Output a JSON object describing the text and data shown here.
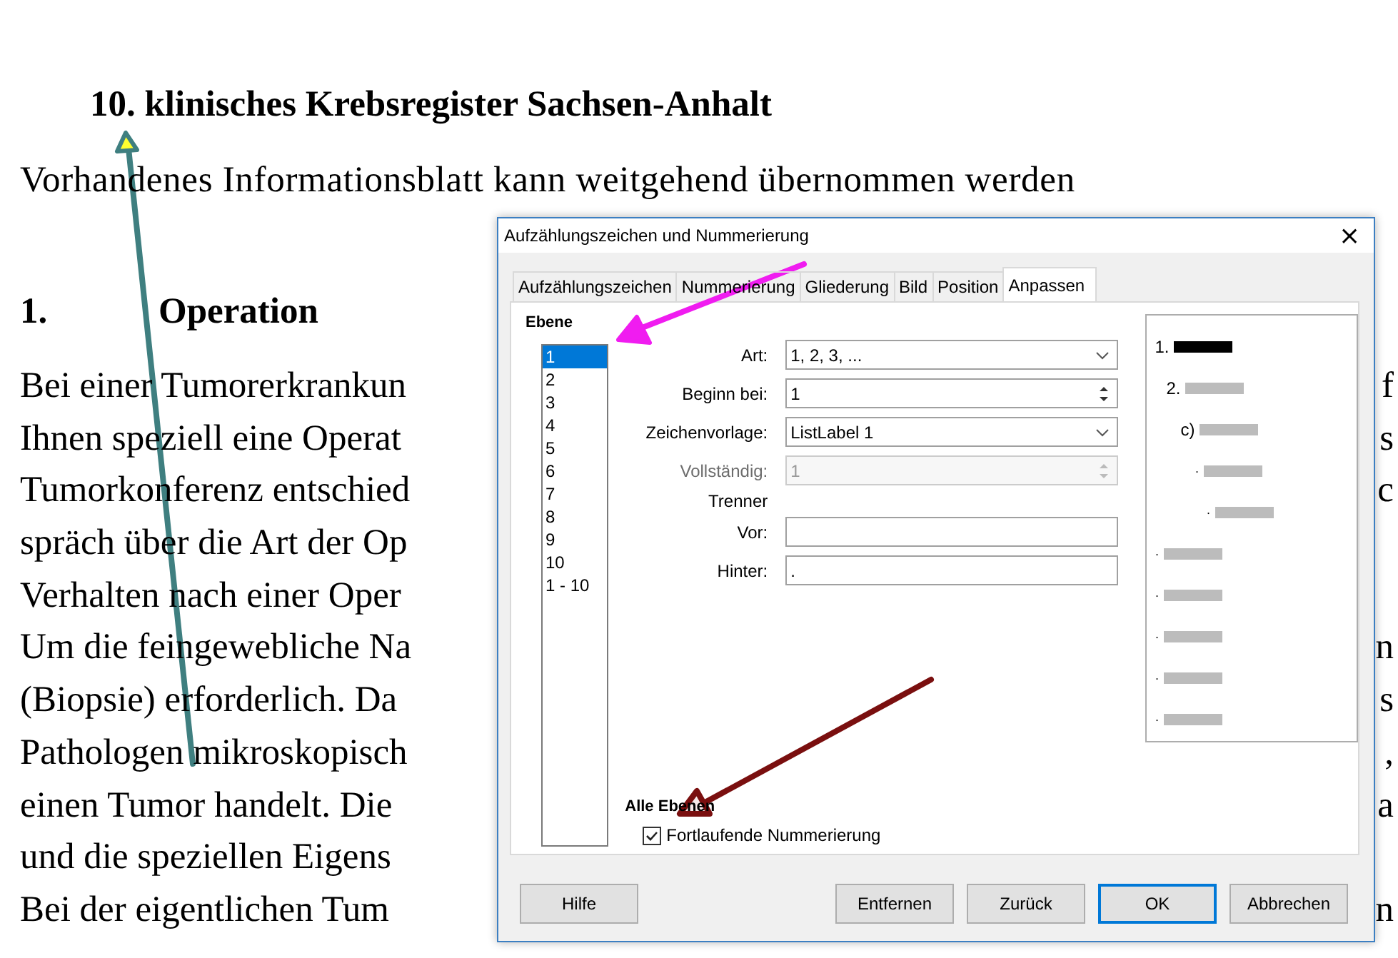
{
  "document": {
    "heading": "10. klinisches Krebsregister Sachsen-Anhalt",
    "intro": "Vorhandenes Informationsblatt kann weitgehend übernommen werden",
    "section": {
      "number": "1.",
      "title": "Operation"
    },
    "lines": [
      {
        "left": "Bei einer Tumorerkrankun",
        "right": "f"
      },
      {
        "left": "Ihnen speziell eine Operat",
        "right": "s"
      },
      {
        "left": "Tumorkonferenz entschied",
        "right": "c"
      },
      {
        "left": "spräch über die Art der Op"
      },
      {
        "left": "Verhalten nach einer Oper"
      },
      {
        "left": "Um die feingewebliche Na",
        "right": "n"
      },
      {
        "left": "(Biopsie) erforderlich. Da",
        "right": "s"
      },
      {
        "left": "Pathologen mikroskopisch",
        "right": ","
      },
      {
        "left": "einen Tumor handelt. Die",
        "right": "a"
      },
      {
        "left": "und die speziellen Eigens"
      },
      {
        "left": "Bei der eigentlichen Tum",
        "right": "n"
      }
    ]
  },
  "dialog": {
    "title": "Aufzählungszeichen und Nummerierung",
    "close": "×",
    "tabs": [
      {
        "label": "Aufzählungszeichen",
        "selected": false
      },
      {
        "label": "Nummerierung",
        "selected": false
      },
      {
        "label": "Gliederung",
        "selected": false
      },
      {
        "label": "Bild",
        "selected": false
      },
      {
        "label": "Position",
        "selected": false
      },
      {
        "label": "Anpassen",
        "selected": true
      }
    ],
    "level_heading": "Ebene",
    "levels": [
      {
        "label": "1",
        "selected": true
      },
      {
        "label": "2",
        "selected": false
      },
      {
        "label": "3",
        "selected": false
      },
      {
        "label": "4",
        "selected": false
      },
      {
        "label": "5",
        "selected": false
      },
      {
        "label": "6",
        "selected": false
      },
      {
        "label": "7",
        "selected": false
      },
      {
        "label": "8",
        "selected": false
      },
      {
        "label": "9",
        "selected": false
      },
      {
        "label": "10",
        "selected": false
      },
      {
        "label": "1 - 10",
        "selected": false
      }
    ],
    "fields": [
      {
        "kind": "dropdown",
        "label": "Art:",
        "value": "1, 2, 3, ..."
      },
      {
        "kind": "spinner",
        "label": "Beginn bei:",
        "value": "1",
        "disabled": false
      },
      {
        "kind": "dropdown",
        "label": "Zeichenvorlage:",
        "value": "ListLabel 1"
      },
      {
        "kind": "spinner",
        "label": "Vollständig:",
        "value": "1",
        "disabled": true
      },
      {
        "kind": "heading",
        "label": "Trenner"
      },
      {
        "kind": "text",
        "label": "Vor:"
      },
      {
        "kind": "text",
        "label": "Hinter:",
        "value": "."
      }
    ],
    "preview": [
      {
        "marker": "1.",
        "highlighted": true
      },
      {
        "marker": "2.",
        "highlighted": false
      },
      {
        "marker": "c)",
        "highlighted": false
      },
      {
        "marker": "·",
        "highlighted": false
      },
      {
        "marker": "·",
        "highlighted": false
      },
      {
        "marker": "·",
        "highlighted": false
      },
      {
        "marker": "·",
        "highlighted": false
      },
      {
        "marker": "·",
        "highlighted": false
      },
      {
        "marker": "·",
        "highlighted": false
      },
      {
        "marker": "·",
        "highlighted": false
      }
    ],
    "all_levels_heading": "Alle Ebenen",
    "continuous": {
      "label": "Fortlaufende Nummerierung",
      "checked": true
    },
    "buttons": [
      {
        "label": "Hilfe",
        "default": false
      },
      {
        "label": "Entfernen",
        "default": false
      },
      {
        "label": "Zurück",
        "default": false
      },
      {
        "label": "OK",
        "default": true
      },
      {
        "label": "Abbrechen",
        "default": false
      }
    ]
  }
}
